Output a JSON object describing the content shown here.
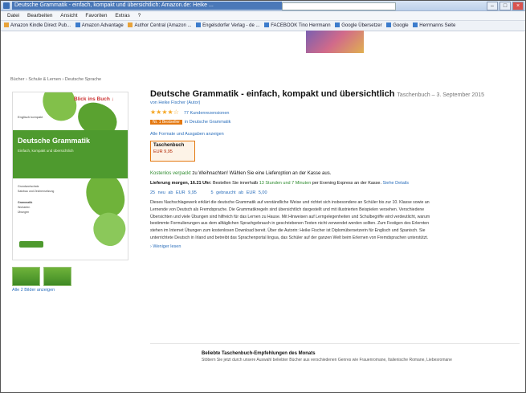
{
  "window": {
    "title": "Deutsche Grammatik - einfach, kompakt und übersichtlich: Amazon.de: Heike ...",
    "min": "–",
    "max": "□",
    "close": "×"
  },
  "menu": [
    "Datei",
    "Bearbeiten",
    "Ansicht",
    "Favoriten",
    "Extras",
    "?"
  ],
  "bookmarks": [
    {
      "label": "Amazon Kindle Direct Pub...",
      "color": "orange"
    },
    {
      "label": "Amazon Advantage",
      "color": "blue"
    },
    {
      "label": "Author Central (Amazon ...",
      "color": "orange"
    },
    {
      "label": "Engelsdorfer Verlag - de ...",
      "color": "blue"
    },
    {
      "label": "FACEBOOK Tino Herrmann",
      "color": "blue"
    },
    {
      "label": "Google Übersetzer",
      "color": "blue"
    },
    {
      "label": "Google",
      "color": "blue"
    },
    {
      "label": "Herrmanns Seite",
      "color": "blue"
    }
  ],
  "breadcrumb": "Bücher › Schule & Lernen › Deutsche Sprache",
  "cover": {
    "badge": "Blick ins Buch ↓",
    "publisher_small": "Englisch kompakt",
    "title": "Deutsche Grammatik",
    "subtitle": "Einfach, kompakt und übersichtlich",
    "lines": [
      "Grundwortschatz",
      "Satzbau und Zeichensetzung",
      "Grammatik",
      "Wortarten",
      "Übungen"
    ]
  },
  "thumb_link": "Alle 2 Bilder anzeigen",
  "product": {
    "title": "Deutsche Grammatik - einfach, kompakt und übersichtlich",
    "binding_date": "Taschenbuch – 3. September 2015",
    "author": "von Heike Fischer (Autor)",
    "stars": "★★★★☆",
    "reviews": "77 Kundenrezensionen",
    "rank_badge": "Nr. 1 Bestseller",
    "rank_text": "in Deutsche Grammatik",
    "formats_link": "Alle Formate und Ausgaben anzeigen",
    "format_name": "Taschenbuch",
    "format_price": "EUR 9,95",
    "gift_prefix": "Kostenlos verpackt",
    "gift_rest": "zu Weihnachten! Wählen Sie eine Lieferoption an der Kasse aus.",
    "delivery_prefix": "Lieferung morgen, 16.21 Uhr:",
    "delivery_mid": "Bestellen Sie innerhalb",
    "delivery_time": "13 Stunden und 7 Minuten",
    "delivery_suffix": "per Evening Express an der Kasse.",
    "delivery_link": "Siehe Details",
    "offers_new": "25 neu ab EUR 9,95",
    "offers_used": "5 gebraucht ab EUR 5,00",
    "description": "Dieses Nachschlagewerk erklärt die deutsche Grammatik auf verständliche Weise und richtet sich insbesondere an Schüler bis zur 10. Klasse sowie an Lernende von Deutsch als Fremdsprache. Die Grammatikregeln sind übersichtlich dargestellt und mit illustrierten Beispielen versehen. Verschiedene Übersichten und viele Übungen sind hilfreich für das Lernen zu Hause. Mit Hinweisen auf Lerngelegenheiten und Schulbegriffe wird verdeutlicht, warum bestimmte Formulierungen aus dem alltäglichen Sprachgebrauch in geschriebenen Texten nicht verwendet werden sollten. Zum Festigen des Erlernten stehen im Internet Übungen zum kostenlosen Download bereit. Über die Autorin: Heike Fischer ist Diplomübersetzerin für Englisch und Spanisch. Sie unterrichtete Deutsch in Irland und betreibt das Sprachenportal lingua, das Schüler auf der ganzen Welt beim Erlernen von Fremdsprachen unterstützt.",
    "more_link": "› Weniger lesen"
  },
  "promo": {
    "heading": "Beliebte Taschenbuch-Empfehlungen des Monats",
    "text": "Stöbern Sie jetzt durch unsere Auswahl beliebter Bücher aus verschiedenen Genres wie Frauenromane, Italienische Romane, Liebesromane"
  }
}
